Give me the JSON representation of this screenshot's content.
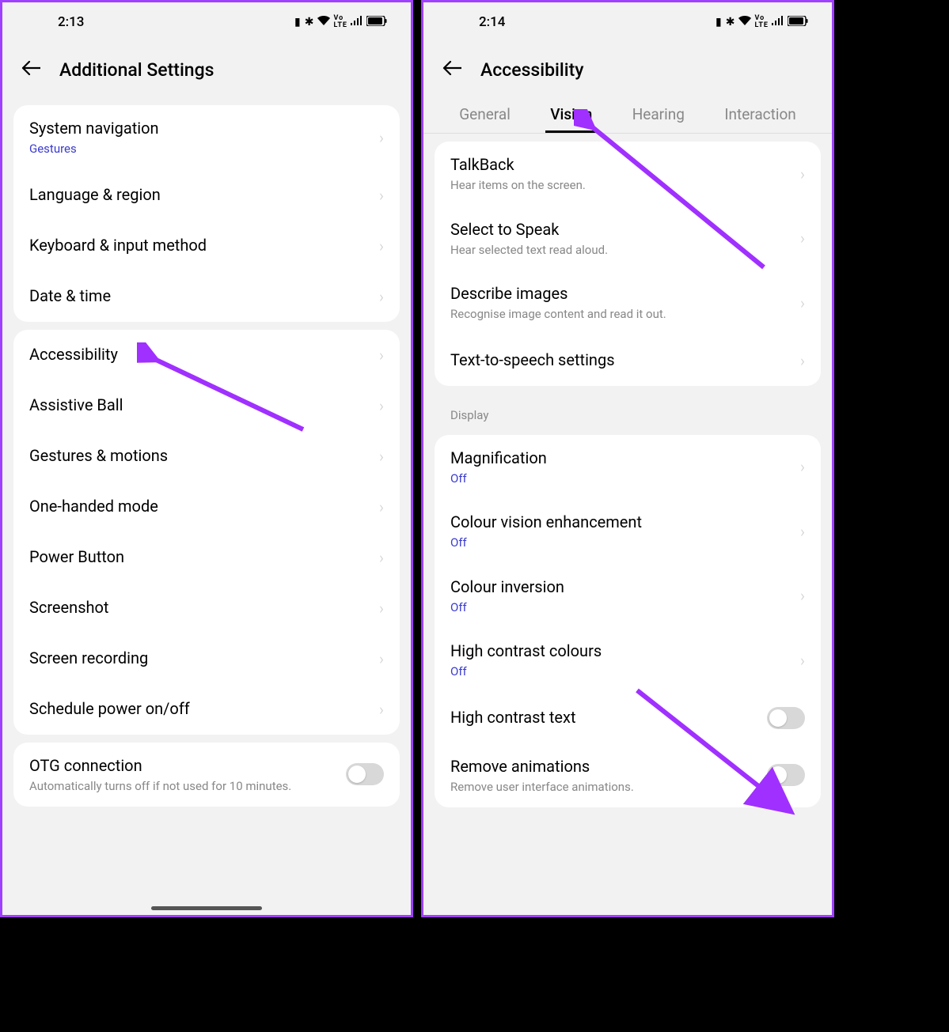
{
  "left": {
    "status_time": "2:13",
    "title": "Additional Settings",
    "group1": [
      {
        "title": "System navigation",
        "sub": "Gestures",
        "subBlue": true
      },
      {
        "title": "Language & region"
      },
      {
        "title": "Keyboard & input method"
      },
      {
        "title": "Date & time"
      }
    ],
    "group2": [
      {
        "title": "Accessibility"
      },
      {
        "title": "Assistive Ball"
      },
      {
        "title": "Gestures & motions"
      },
      {
        "title": "One-handed mode"
      },
      {
        "title": "Power Button"
      },
      {
        "title": "Screenshot"
      },
      {
        "title": "Screen recording"
      },
      {
        "title": "Schedule power on/off"
      }
    ],
    "group3": [
      {
        "title": "OTG connection",
        "sub": "Automatically turns off if not used for 10 minutes.",
        "toggle": true
      }
    ]
  },
  "right": {
    "status_time": "2:14",
    "title": "Accessibility",
    "tabs": [
      "General",
      "Vision",
      "Hearing",
      "Interaction"
    ],
    "active_tab": "Vision",
    "group1": [
      {
        "title": "TalkBack",
        "sub": "Hear items on the screen."
      },
      {
        "title": "Select to Speak",
        "sub": "Hear selected text read aloud."
      },
      {
        "title": "Describe images",
        "sub": "Recognise image content and read it out."
      },
      {
        "title": "Text-to-speech settings"
      }
    ],
    "section_label": "Display",
    "group2": [
      {
        "title": "Magnification",
        "sub": "Off",
        "subBlue": true
      },
      {
        "title": "Colour vision enhancement",
        "sub": "Off",
        "subBlue": true
      },
      {
        "title": "Colour inversion",
        "sub": "Off",
        "subBlue": true
      },
      {
        "title": "High contrast colours",
        "sub": "Off",
        "subBlue": true
      },
      {
        "title": "High contrast text",
        "toggle": true
      },
      {
        "title": "Remove animations",
        "sub": "Remove user interface animations.",
        "toggle": true
      }
    ]
  }
}
